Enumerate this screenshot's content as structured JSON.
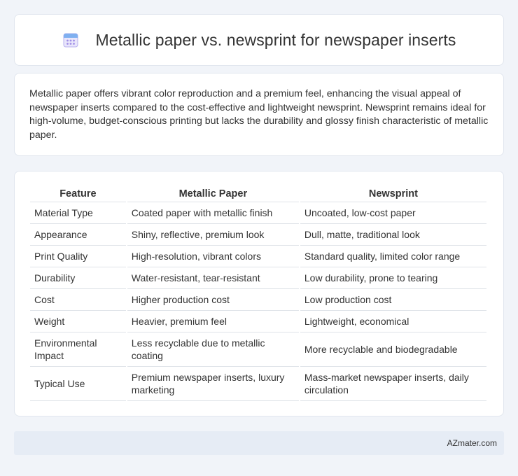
{
  "header": {
    "title": "Metallic paper vs. newsprint for newspaper inserts",
    "icon": "calendar-icon"
  },
  "summary": {
    "text": "Metallic paper offers vibrant color reproduction and a premium feel, enhancing the visual appeal of newspaper inserts compared to the cost-effective and lightweight newsprint. Newsprint remains ideal for high-volume, budget-conscious printing but lacks the durability and glossy finish characteristic of metallic paper."
  },
  "table": {
    "headers": [
      "Feature",
      "Metallic Paper",
      "Newsprint"
    ],
    "rows": [
      [
        "Material Type",
        "Coated paper with metallic finish",
        "Uncoated, low-cost paper"
      ],
      [
        "Appearance",
        "Shiny, reflective, premium look",
        "Dull, matte, traditional look"
      ],
      [
        "Print Quality",
        "High-resolution, vibrant colors",
        "Standard quality, limited color range"
      ],
      [
        "Durability",
        "Water-resistant, tear-resistant",
        "Low durability, prone to tearing"
      ],
      [
        "Cost",
        "Higher production cost",
        "Low production cost"
      ],
      [
        "Weight",
        "Heavier, premium feel",
        "Lightweight, economical"
      ],
      [
        "Environmental Impact",
        "Less recyclable due to metallic coating",
        "More recyclable and biodegradable"
      ],
      [
        "Typical Use",
        "Premium newspaper inserts, luxury marketing",
        "Mass-market newspaper inserts, daily circulation"
      ]
    ]
  },
  "footer": {
    "brand": "AZmater.com"
  },
  "colors": {
    "page_background": "#f1f4f9",
    "card_background": "#ffffff",
    "footer_background": "#e6ecf5",
    "icon_accent": "#8a7fd8"
  }
}
